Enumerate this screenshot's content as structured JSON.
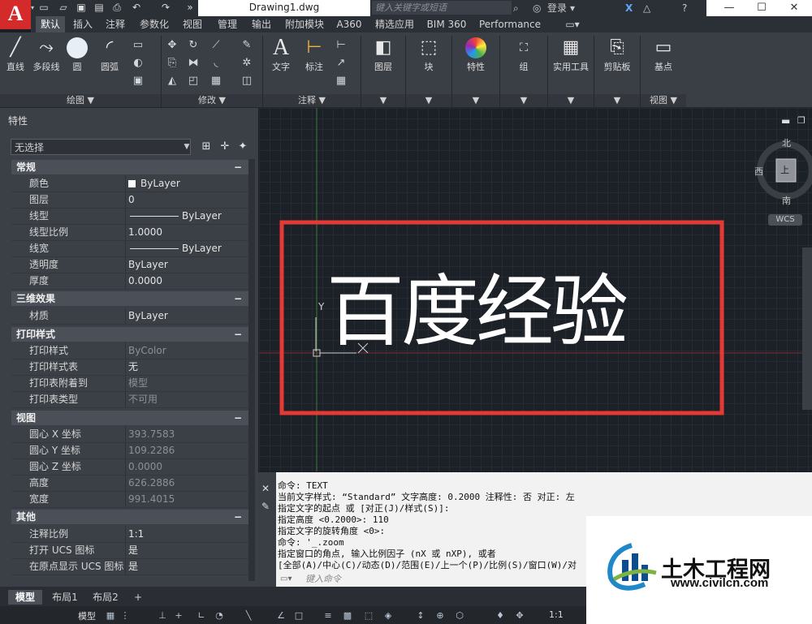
{
  "app": {
    "logo": "A",
    "document_title": "Drawing1.dwg"
  },
  "search": {
    "placeholder": "键入关键字或短语"
  },
  "account": {
    "login_label": "登录"
  },
  "ribbon_tabs": [
    "默认",
    "插入",
    "注释",
    "参数化",
    "视图",
    "管理",
    "输出",
    "附加模块",
    "A360",
    "精选应用",
    "BIM 360",
    "Performance"
  ],
  "ribbon": {
    "draw": {
      "line": "直线",
      "polyline": "多段线",
      "circle": "圆",
      "arc": "圆弧",
      "panel": "绘图 ▼"
    },
    "modify": {
      "panel": "修改 ▼"
    },
    "annotation": {
      "text": "文字",
      "dimension": "标注",
      "panel": "注释 ▼"
    },
    "layers": "图层",
    "block": "块",
    "properties": "特性",
    "group": "组",
    "utilities": "实用工具",
    "clipboard": "剪贴板",
    "base": "基点",
    "view_panel": "视图 ▼"
  },
  "properties": {
    "title": "特性",
    "selection": "无选择",
    "sections": {
      "general": "常规",
      "3d": "三维效果",
      "plot": "打印样式",
      "view": "视图",
      "misc": "其他"
    },
    "general": [
      {
        "key": "颜色",
        "value": "ByLayer"
      },
      {
        "key": "图层",
        "value": "0"
      },
      {
        "key": "线型",
        "value": "ByLayer"
      },
      {
        "key": "线型比例",
        "value": "1.0000"
      },
      {
        "key": "线宽",
        "value": "ByLayer"
      },
      {
        "key": "透明度",
        "value": "ByLayer"
      },
      {
        "key": "厚度",
        "value": "0.0000"
      }
    ],
    "three_d": [
      {
        "key": "材质",
        "value": "ByLayer"
      }
    ],
    "plot": [
      {
        "key": "打印样式",
        "value": "ByColor"
      },
      {
        "key": "打印样式表",
        "value": "无"
      },
      {
        "key": "打印表附着到",
        "value": "模型"
      },
      {
        "key": "打印表类型",
        "value": "不可用"
      }
    ],
    "view": [
      {
        "key": "圆心 X 坐标",
        "value": "393.7583"
      },
      {
        "key": "圆心 Y 坐标",
        "value": "109.2286"
      },
      {
        "key": "圆心 Z 坐标",
        "value": "0.0000"
      },
      {
        "key": "高度",
        "value": "626.2886"
      },
      {
        "key": "宽度",
        "value": "991.4015"
      }
    ],
    "misc": [
      {
        "key": "注释比例",
        "value": "1:1"
      },
      {
        "key": "打开 UCS 图标",
        "value": "是"
      },
      {
        "key": "在原点显示 UCS 图标",
        "value": "是"
      }
    ]
  },
  "canvas": {
    "drawn_text": "百度经验",
    "ucs_y": "Y",
    "compass": {
      "north": "北",
      "south": "南",
      "west": "西",
      "top": "上"
    },
    "wcs": "WCS"
  },
  "command": {
    "lines": [
      "命令:  TEXT",
      "当前文字样式:  “Standard”  文字高度:  0.2000  注释性:  否  对正:  左",
      "指定文字的起点 或 [对正(J)/样式(S)]:",
      "指定高度 <0.2000>: 110",
      "指定文字的旋转角度 <0>:",
      "命令: '_.zoom",
      "指定窗口的角点, 输入比例因子 (nX 或 nXP), 或者",
      "[全部(A)/中心(C)/动态(D)/范围(E)/上一个(P)/比例(S)/窗口(W)/对"
    ],
    "input_placeholder": "键入命令"
  },
  "layouts": [
    "模型",
    "布局1",
    "布局2"
  ],
  "status": {
    "model": "模型",
    "scale": "1:1"
  },
  "watermark": {
    "name": "土木工程网",
    "url": "www.civilcn.com"
  },
  "colors": {
    "accent_red": "#e53935",
    "app_red": "#d42a2a",
    "canvas_bg": "#1c2027"
  }
}
